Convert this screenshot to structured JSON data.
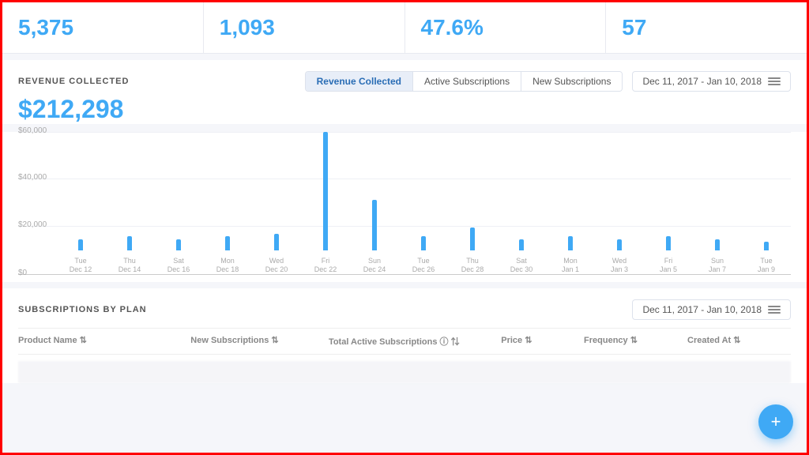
{
  "metrics": [
    {
      "id": "metric-1",
      "value": "5,375"
    },
    {
      "id": "metric-2",
      "value": "1,093"
    },
    {
      "id": "metric-3",
      "value": "47.6%"
    },
    {
      "id": "metric-4",
      "value": "57"
    }
  ],
  "revenue": {
    "section_label": "REVENUE COLLECTED",
    "amount": "$212,298",
    "tabs": [
      {
        "id": "tab-revenue",
        "label": "Revenue Collected",
        "active": true
      },
      {
        "id": "tab-active",
        "label": "Active Subscriptions",
        "active": false
      },
      {
        "id": "tab-new",
        "label": "New Subscriptions",
        "active": false
      }
    ],
    "date_range": "Dec 11, 2017 - Jan 10, 2018"
  },
  "chart": {
    "y_labels": [
      "$60,000",
      "$40,000",
      "$20,000",
      "$0"
    ],
    "bars": [
      {
        "label": "Tue\nDec 12",
        "height": 4
      },
      {
        "label": "Thu\nDec 14",
        "height": 5
      },
      {
        "label": "Sat\nDec 16",
        "height": 4
      },
      {
        "label": "Mon\nDec 18",
        "height": 5
      },
      {
        "label": "Wed\nDec 20",
        "height": 6
      },
      {
        "label": "Fri\nDec 22",
        "height": 42
      },
      {
        "label": "Sun\nDec 24",
        "height": 18
      },
      {
        "label": "Tue\nDec 26",
        "height": 5
      },
      {
        "label": "Thu\nDec 28",
        "height": 8
      },
      {
        "label": "Sat\nDec 30",
        "height": 4
      },
      {
        "label": "Mon\nJan 1",
        "height": 5
      },
      {
        "label": "Wed\nJan 3",
        "height": 4
      },
      {
        "label": "Fri\nJan 5",
        "height": 5
      },
      {
        "label": "Sun\nJan 7",
        "height": 4
      },
      {
        "label": "Tue\nJan 9",
        "height": 3
      }
    ]
  },
  "subscriptions": {
    "section_label": "SUBSCRIPTIONS BY PLAN",
    "date_range": "Dec 11, 2017 - Jan 10, 2018",
    "columns": [
      {
        "id": "col-product",
        "label": "Product Name",
        "sortable": true
      },
      {
        "id": "col-new-subs",
        "label": "New Subscriptions",
        "sortable": true
      },
      {
        "id": "col-active-subs",
        "label": "Total Active Subscriptions",
        "sortable": true,
        "info": true
      },
      {
        "id": "col-price",
        "label": "Price",
        "sortable": true
      },
      {
        "id": "col-frequency",
        "label": "Frequency",
        "sortable": true
      },
      {
        "id": "col-created",
        "label": "Created At",
        "sortable": true
      }
    ]
  },
  "icons": {
    "menu": "≡",
    "sort": "⇅",
    "info": "ⓘ",
    "plus": "+"
  }
}
